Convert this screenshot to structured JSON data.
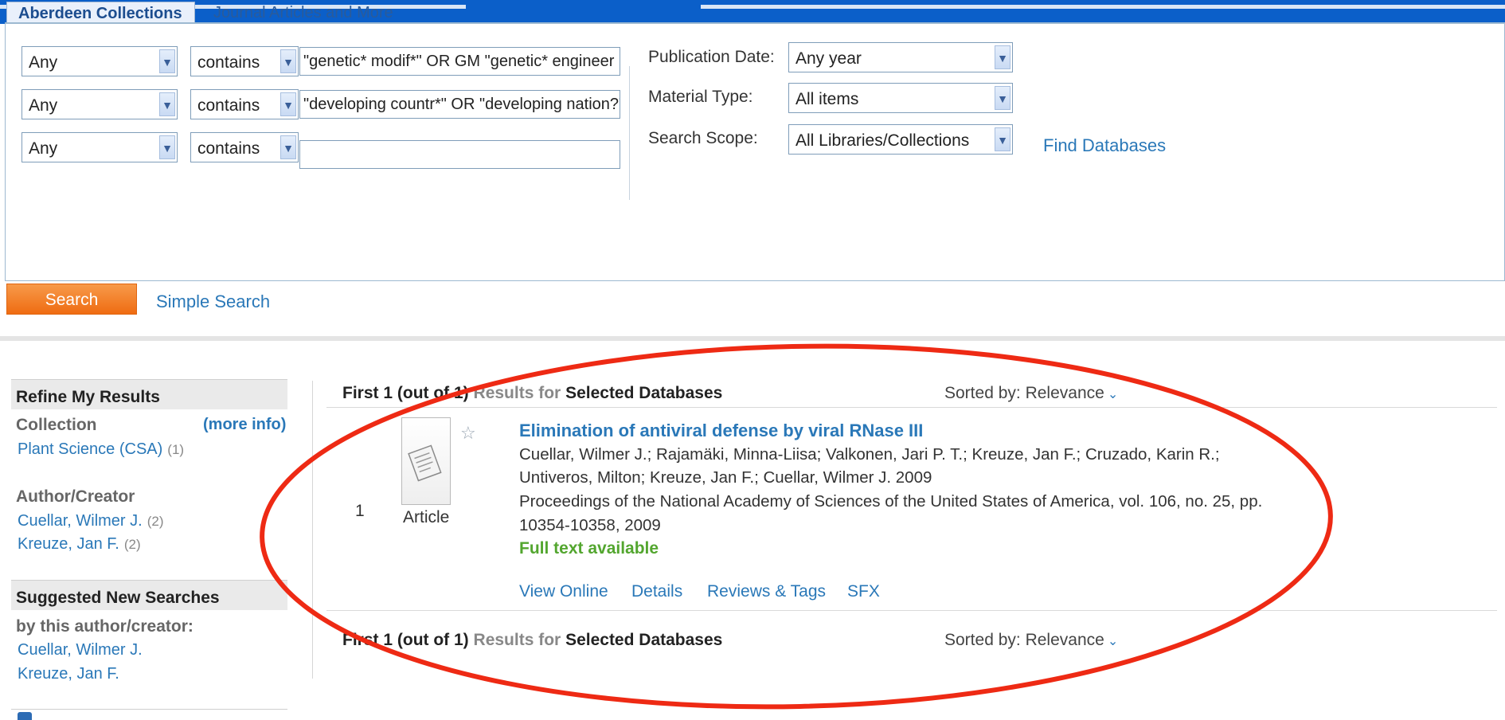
{
  "tabs": [
    {
      "label": "Aberdeen Collections"
    },
    {
      "label": "Journal Articles and More"
    }
  ],
  "search": {
    "rows": [
      {
        "field": "Any",
        "operator": "contains",
        "query": "\"genetic* modif*\" OR GM \"genetic* engineer"
      },
      {
        "field": "Any",
        "operator": "contains",
        "query": "\"developing countr*\" OR \"developing nation?\""
      },
      {
        "field": "Any",
        "operator": "contains",
        "query": ""
      }
    ],
    "filters": [
      {
        "label": "Publication Date:",
        "value": "Any year"
      },
      {
        "label": "Material Type:",
        "value": "All items"
      },
      {
        "label": "Search Scope:",
        "value": "All Libraries/Collections"
      }
    ],
    "find_databases": "Find Databases",
    "search_button": "Search",
    "simple_search": "Simple Search"
  },
  "sidebar": {
    "refine_header": "Refine My Results",
    "collection_label": "Collection",
    "more_info": "(more info)",
    "collection_items": [
      {
        "label": "Plant Science (CSA)",
        "count": "(1)"
      }
    ],
    "author_label": "Author/Creator",
    "author_items": [
      {
        "label": "Cuellar, Wilmer J.",
        "count": "(2)"
      },
      {
        "label": "Kreuze, Jan F.",
        "count": "(2)"
      }
    ],
    "suggested_header": "Suggested New Searches",
    "by_author_label": "by this author/creator:",
    "suggested_items": [
      {
        "label": "Cuellar, Wilmer J."
      },
      {
        "label": "Kreuze, Jan F."
      }
    ]
  },
  "results": {
    "first_prefix": "First 1",
    "out_of": "(out of 1)",
    "results_for": "Results for",
    "selected": "Selected Databases",
    "sorted_by": "Sorted by:",
    "sort_value": "Relevance",
    "items": [
      {
        "number": "1",
        "type": "Article",
        "title": "Elimination of antiviral defense by viral RNase III",
        "authors_line1": "Cuellar, Wilmer J.; Rajamäki, Minna-Liisa; Valkonen, Jari P. T.; Kreuze, Jan F.; Cruzado, Karin R.;",
        "authors_line2": "Untiveros, Milton; Kreuze, Jan F.; Cuellar, Wilmer J. 2009",
        "source_line1": "Proceedings of the National Academy of Sciences of the United States of America, vol. 106, no. 25, pp.",
        "source_line2": "10354-10358, 2009",
        "fulltext": "Full text available",
        "actions": [
          "View Online",
          "Details",
          "Reviews & Tags",
          "SFX"
        ]
      }
    ]
  },
  "colors": {
    "topbar": "#0b5fc9",
    "link": "#2a78b8",
    "search_button": "#ef6c12",
    "fulltext": "#53a62f",
    "annotation": "#ee2a14"
  }
}
